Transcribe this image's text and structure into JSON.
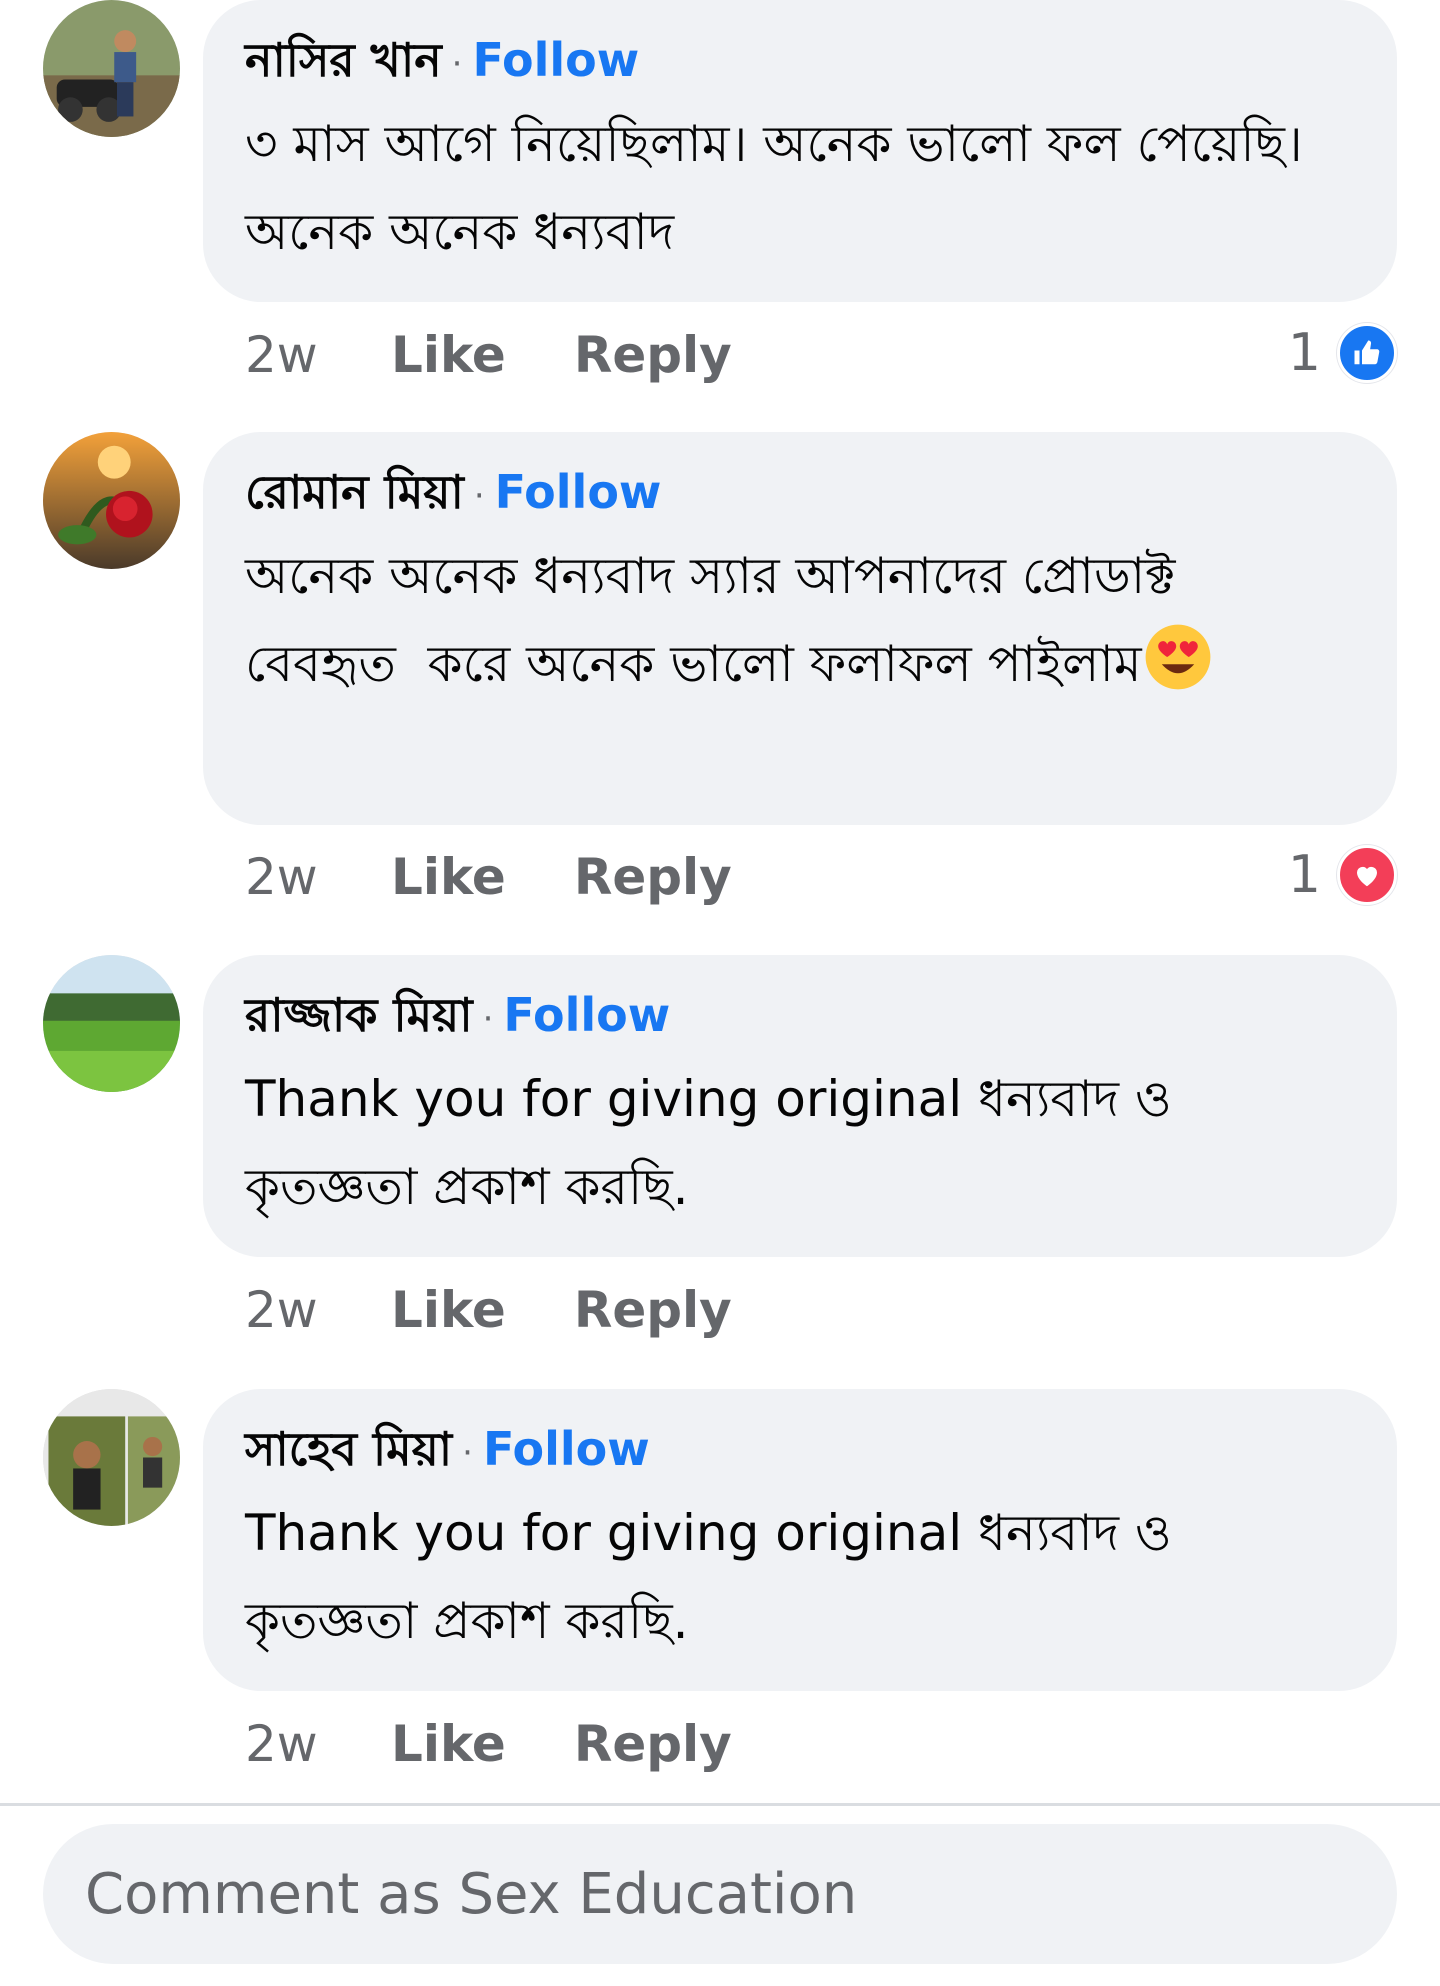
{
  "comments": [
    {
      "author": "নাসির খান",
      "follow": "Follow",
      "text": "৩ মাস আগে নিয়েছিলাম। অনেক ভালো ফল পেয়েছি।  অনেক অনেক ধন্যবাদ",
      "time": "2w",
      "like": "Like",
      "reply": "Reply",
      "reaction_count": "1",
      "reaction_icon": "like-icon"
    },
    {
      "author": "রোমান মিয়া",
      "follow": "Follow",
      "text": "অনেক অনেক ধন্যবাদ স্যার আপনাদের প্রোডাক্ট  বেবহৃত  করে অনেক ভালো ফলাফল পাইলাম",
      "emoji": "heart-eyes-emoji",
      "time": "2w",
      "like": "Like",
      "reply": "Reply",
      "reaction_count": "1",
      "reaction_icon": "love-icon"
    },
    {
      "author": "রাজ্জাক মিয়া",
      "follow": "Follow",
      "text": "Thank you for giving original ধন্যবাদ ও কৃতজ্ঞতা প্রকাশ করছি.",
      "time": "2w",
      "like": "Like",
      "reply": "Reply"
    },
    {
      "author": "সাহেব মিয়া",
      "follow": "Follow",
      "text": "Thank you for giving original ধন্যবাদ ও কৃতজ্ঞতা প্রকাশ করছি.",
      "time": "2w",
      "like": "Like",
      "reply": "Reply"
    }
  ],
  "composer": {
    "placeholder": "Comment as Sex Education"
  },
  "colors": {
    "accent": "#1877f2",
    "love": "#f33e58",
    "bubble": "#f0f2f5",
    "muted": "#65676b"
  }
}
